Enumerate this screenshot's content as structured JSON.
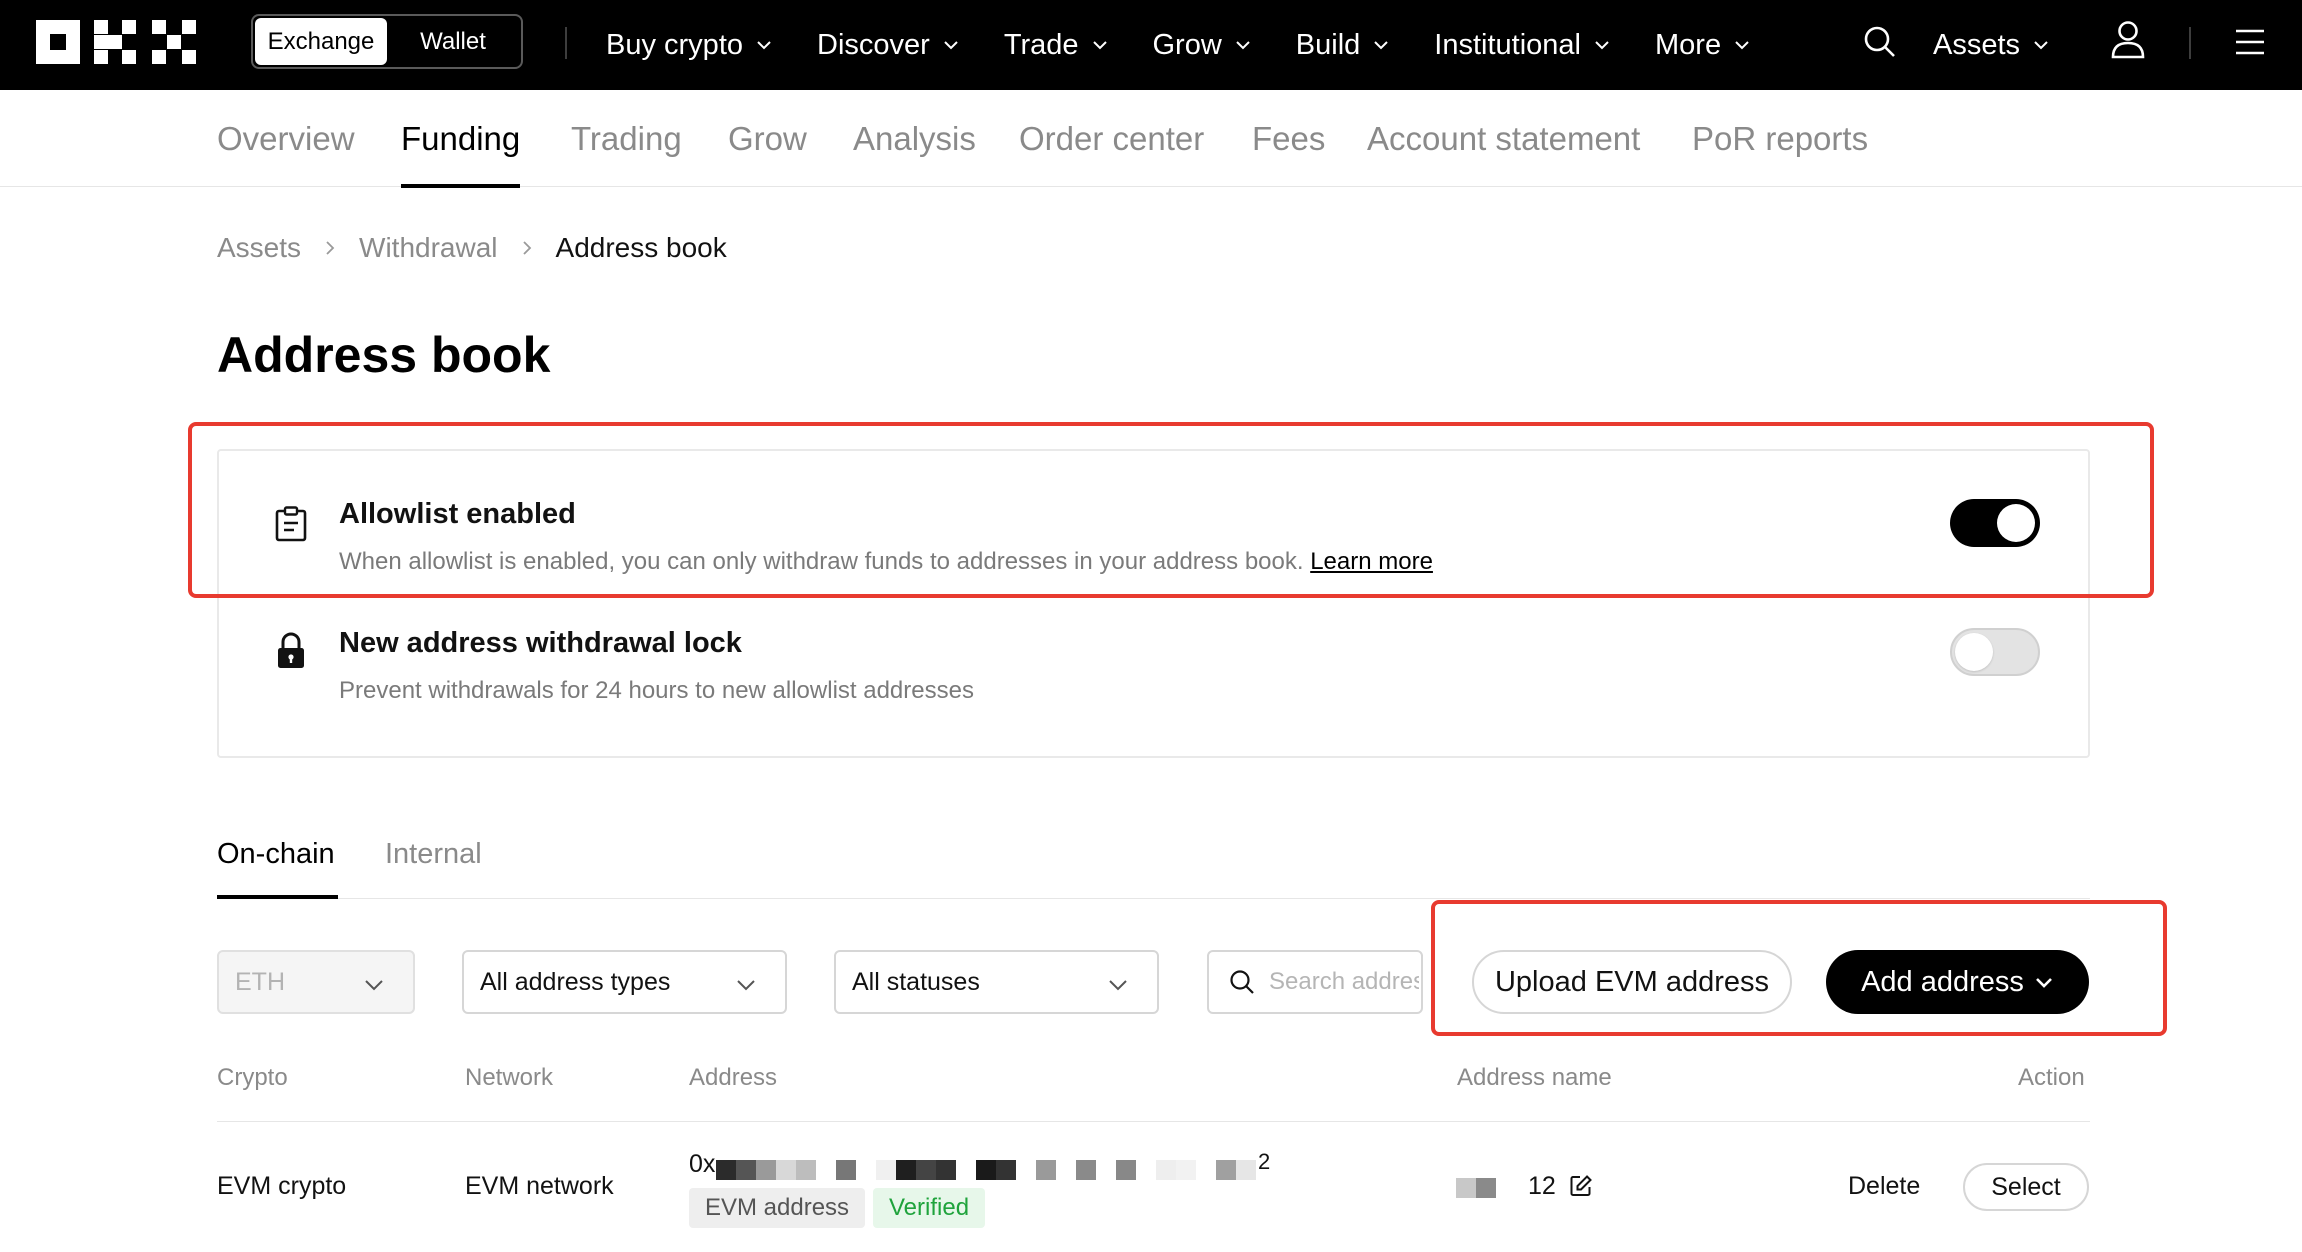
{
  "topnav": {
    "segments": [
      {
        "label": "Exchange",
        "active": true
      },
      {
        "label": "Wallet",
        "active": false
      }
    ],
    "items": [
      {
        "label": "Buy crypto"
      },
      {
        "label": "Discover"
      },
      {
        "label": "Trade"
      },
      {
        "label": "Grow"
      },
      {
        "label": "Build"
      },
      {
        "label": "Institutional"
      },
      {
        "label": "More"
      }
    ],
    "assets_label": "Assets"
  },
  "subnav": {
    "tabs": [
      {
        "label": "Overview",
        "active": false
      },
      {
        "label": "Funding",
        "active": true
      },
      {
        "label": "Trading",
        "active": false
      },
      {
        "label": "Grow",
        "active": false
      },
      {
        "label": "Analysis",
        "active": false
      },
      {
        "label": "Order center",
        "active": false
      },
      {
        "label": "Fees",
        "active": false
      },
      {
        "label": "Account statement",
        "active": false
      },
      {
        "label": "PoR reports",
        "active": false
      }
    ]
  },
  "breadcrumb": {
    "items": [
      "Assets",
      "Withdrawal",
      "Address book"
    ]
  },
  "page_title": "Address book",
  "settings": {
    "allowlist": {
      "title": "Allowlist enabled",
      "description": "When allowlist is enabled, you can only withdraw funds to addresses in your address book.",
      "learn_more": "Learn more",
      "enabled": true
    },
    "lock": {
      "title": "New address withdrawal lock",
      "description": "Prevent withdrawals for 24 hours to new allowlist addresses",
      "enabled": false
    }
  },
  "address_tabs": [
    {
      "label": "On-chain",
      "active": true
    },
    {
      "label": "Internal",
      "active": false
    }
  ],
  "filters": {
    "crypto": "ETH",
    "address_type": "All address types",
    "status": "All statuses",
    "search_placeholder": "Search address"
  },
  "buttons": {
    "upload": "Upload EVM address",
    "add": "Add address"
  },
  "table": {
    "headers": {
      "crypto": "Crypto",
      "network": "Network",
      "address": "Address",
      "address_name": "Address name",
      "action": "Action"
    },
    "rows": [
      {
        "crypto": "EVM crypto",
        "network": "EVM network",
        "address_prefix": "0x",
        "address_suffix": "2",
        "tag_type": "EVM address",
        "tag_status": "Verified",
        "address_name_suffix": "12",
        "delete": "Delete",
        "select": "Select"
      }
    ]
  },
  "colors": {
    "accent": "#000000",
    "highlight": "#e83a2f",
    "verified_text": "#1fa33c",
    "verified_bg": "#e7f7ea"
  }
}
